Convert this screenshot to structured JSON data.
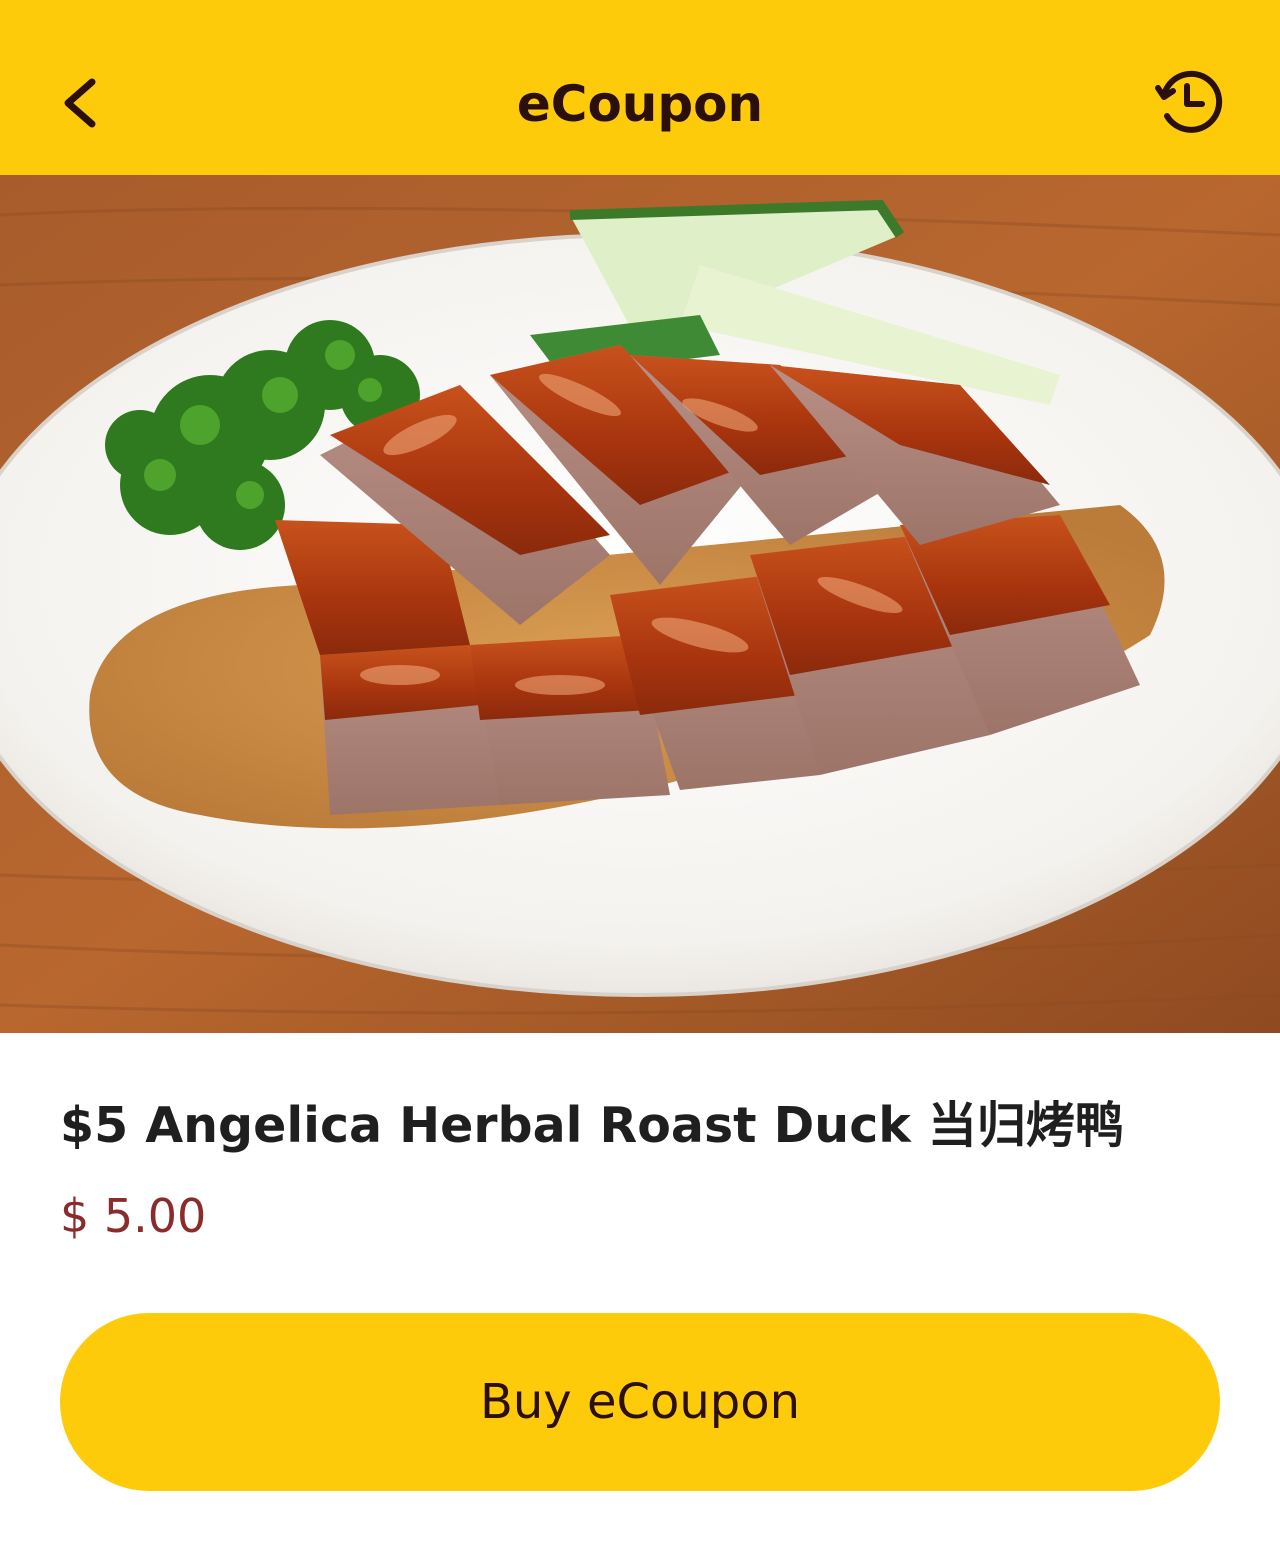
{
  "header": {
    "title": "eCoupon",
    "back_icon": "chevron-left-icon",
    "history_icon": "history-clock-icon",
    "background_color": "#FECB0A"
  },
  "hero": {
    "image_subject": "roast duck with parsley and cucumber on white plate"
  },
  "product": {
    "title": "$5 Angelica Herbal Roast Duck 当归烤鸭",
    "price": "$ 5.00",
    "price_color": "#8B2C2C"
  },
  "actions": {
    "buy_label": "Buy eCoupon",
    "button_color": "#FECB0A"
  }
}
